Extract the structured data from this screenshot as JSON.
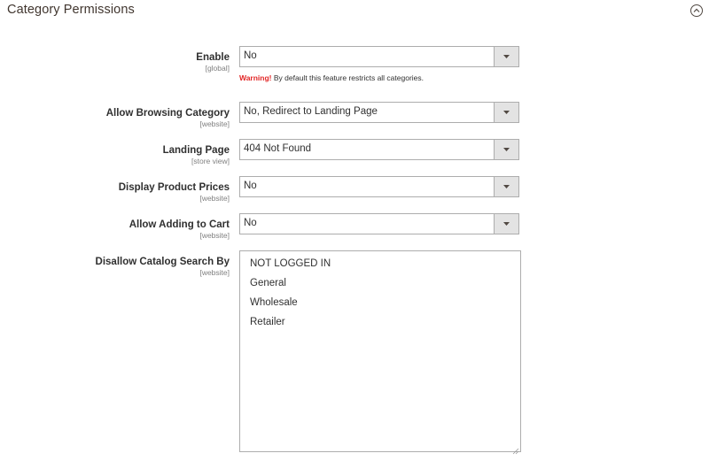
{
  "section": {
    "title": "Category Permissions",
    "collapse_icon": "chevron-up-circle-icon"
  },
  "fields": {
    "enable": {
      "label": "Enable",
      "scope": "[global]",
      "value": "No",
      "warning_strong": "Warning!",
      "warning_text": " By default this feature restricts all categories."
    },
    "allow_browsing": {
      "label": "Allow Browsing Category",
      "scope": "[website]",
      "value": "No, Redirect to Landing Page"
    },
    "landing_page": {
      "label": "Landing Page",
      "scope": "[store view]",
      "value": "404 Not Found"
    },
    "display_prices": {
      "label": "Display Product Prices",
      "scope": "[website]",
      "value": "No"
    },
    "allow_cart": {
      "label": "Allow Adding to Cart",
      "scope": "[website]",
      "value": "No"
    },
    "disallow_search": {
      "label": "Disallow Catalog Search By",
      "scope": "[website]",
      "options": [
        "NOT LOGGED IN",
        "General",
        "Wholesale",
        "Retailer"
      ]
    }
  },
  "colors": {
    "warning": "#e22626",
    "border": "#adadad",
    "select_button_bg": "#e3e3e3"
  }
}
